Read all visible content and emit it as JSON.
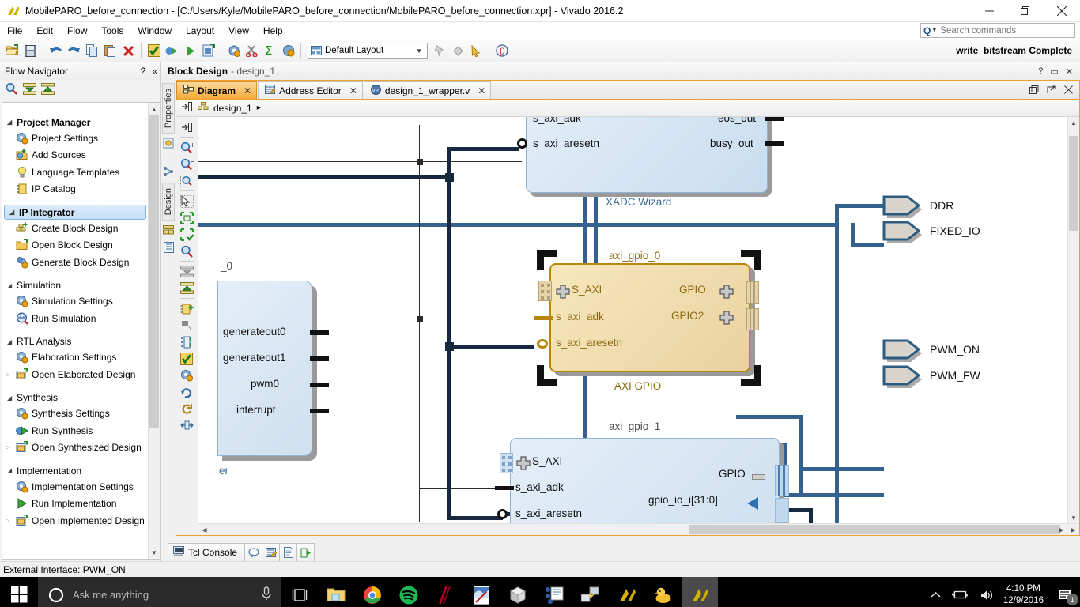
{
  "window": {
    "title": "MobilePARO_before_connection - [C:/Users/Kyle/MobilePARO_before_connection/MobilePARO_before_connection.xpr] - Vivado 2016.2",
    "minimize_label": "Minimize",
    "restore_label": "Restore",
    "close_label": "Close"
  },
  "menubar": {
    "items": [
      "File",
      "Edit",
      "Flow",
      "Tools",
      "Window",
      "Layout",
      "View",
      "Help"
    ]
  },
  "search": {
    "placeholder": "Search commands",
    "value": ""
  },
  "toolbar": {
    "layout_label": "Default Layout",
    "status_text": "write_bitstream Complete",
    "buttons": [
      "open-project-icon",
      "save-icon",
      "undo-icon",
      "redo-icon",
      "copy-icon",
      "paste-icon",
      "delete-icon",
      "validate-icon",
      "run-synthesis-icon",
      "run-implementation-icon",
      "generate-bitstream-icon",
      "settings-icon",
      "cut-icon",
      "report-icon",
      "timing-icon"
    ]
  },
  "flow_navigator": {
    "title": "Flow Navigator",
    "help_glyph": "?",
    "collapse_glyph": "«",
    "tools": [
      "search-icon",
      "collapse-all-icon",
      "expand-all-icon"
    ],
    "sections": [
      {
        "label": "Project Manager",
        "bold": true,
        "selected": false,
        "items": [
          {
            "label": "Project Settings",
            "icon": "gear-icon"
          },
          {
            "label": "Add Sources",
            "icon": "add-sources-icon"
          },
          {
            "label": "Language Templates",
            "icon": "bulb-icon"
          },
          {
            "label": "IP Catalog",
            "icon": "ip-catalog-icon"
          }
        ]
      },
      {
        "label": "IP Integrator",
        "bold": true,
        "selected": true,
        "items": [
          {
            "label": "Create Block Design",
            "icon": "create-block-design-icon"
          },
          {
            "label": "Open Block Design",
            "icon": "open-folder-icon"
          },
          {
            "label": "Generate Block Design",
            "icon": "generate-icon"
          }
        ]
      },
      {
        "label": "Simulation",
        "bold": false,
        "selected": false,
        "items": [
          {
            "label": "Simulation Settings",
            "icon": "gear-icon"
          },
          {
            "label": "Run Simulation",
            "icon": "run-simulation-icon"
          }
        ]
      },
      {
        "label": "RTL Analysis",
        "bold": false,
        "selected": false,
        "items": [
          {
            "label": "Elaboration Settings",
            "icon": "gear-icon"
          },
          {
            "label": "Open Elaborated Design",
            "icon": "open-folder-icon",
            "expander": true
          }
        ]
      },
      {
        "label": "Synthesis",
        "bold": false,
        "selected": false,
        "items": [
          {
            "label": "Synthesis Settings",
            "icon": "gear-icon"
          },
          {
            "label": "Run Synthesis",
            "icon": "run-synthesis-icon"
          },
          {
            "label": "Open Synthesized Design",
            "icon": "open-folder-icon",
            "expander": true
          }
        ]
      },
      {
        "label": "Implementation",
        "bold": false,
        "selected": false,
        "items": [
          {
            "label": "Implementation Settings",
            "icon": "gear-icon"
          },
          {
            "label": "Run Implementation",
            "icon": "play-icon"
          },
          {
            "label": "Open Implemented Design",
            "icon": "open-folder-icon",
            "expander": true
          }
        ]
      }
    ]
  },
  "block_design": {
    "header_title": "Block Design",
    "header_sub": "- design_1",
    "side_tabs": [
      {
        "label": "Properties",
        "icon": "properties-icon"
      },
      {
        "label": "Design",
        "icon": "design-icon"
      }
    ],
    "tabs": [
      {
        "label": "Diagram",
        "icon": "diagram-icon",
        "active": true,
        "closable": true
      },
      {
        "label": "Address Editor",
        "icon": "address-editor-icon",
        "active": false,
        "closable": true
      },
      {
        "label": "design_1_wrapper.v",
        "icon": "verilog-icon",
        "active": false,
        "closable": true
      }
    ],
    "breadcrumb": {
      "root": "design_1",
      "arrow": "▸"
    },
    "canvas_tools": [
      "select-area-icon",
      "zoom-in-icon",
      "zoom-out-icon",
      "zoom-fit-icon",
      "select-tool-icon",
      "fit-selection-icon",
      "auto-fit-icon",
      "search-icon",
      "collapse-all-icon",
      "expand-all-icon",
      "add-ip-icon",
      "pointer-icon",
      "regenerate-layout-icon",
      "validate-design-icon",
      "settings-icon",
      "refresh-icon",
      "redo-icon",
      "resize-icon"
    ]
  },
  "diagram": {
    "blocks": [
      {
        "id": "xadc",
        "instance_name": "",
        "type_name": "XADC Wizard",
        "style": "blue",
        "input_pins": [
          "s_axi_adk",
          "s_axi_aresetn"
        ],
        "output_pins": [
          "eos_out",
          "busy_out"
        ]
      },
      {
        "id": "timer",
        "instance_name": "_0",
        "type_name": "er",
        "style": "blue",
        "input_pins": [],
        "output_pins": [
          "generateout0",
          "generateout1",
          "pwm0",
          "interrupt"
        ]
      },
      {
        "id": "axi_gpio_0",
        "instance_name": "axi_gpio_0",
        "type_name": "AXI GPIO",
        "style": "gold-selected",
        "bus_pins_in": [
          "S_AXI"
        ],
        "input_pins": [
          "s_axi_adk",
          "s_axi_aresetn"
        ],
        "bus_pins_out": [
          "GPIO",
          "GPIO2"
        ]
      },
      {
        "id": "axi_gpio_1",
        "instance_name": "axi_gpio_1",
        "type_name": "",
        "style": "blue",
        "bus_pins_in": [
          "S_AXI"
        ],
        "input_pins": [
          "s_axi_adk",
          "s_axi_aresetn"
        ],
        "output_pins": [
          "GPIO",
          "gpio_io_i[31:0]"
        ]
      }
    ],
    "external_ports": [
      {
        "label": "DDR"
      },
      {
        "label": "FIXED_IO"
      },
      {
        "label": "PWM_ON"
      },
      {
        "label": "PWM_FW"
      }
    ]
  },
  "console": {
    "tab_label": "Tcl Console",
    "tab_icon": "console-icon",
    "extra_icons": [
      "messages-icon",
      "log-icon",
      "reports-icon",
      "designruns-icon"
    ]
  },
  "statusbar": {
    "text": "External Interface: PWM_ON"
  },
  "taskbar": {
    "cortana_placeholder": "Ask me anything",
    "apps": [
      {
        "name": "file-explorer",
        "running": true
      },
      {
        "name": "google-chrome",
        "running": false
      },
      {
        "name": "spotify",
        "running": false
      },
      {
        "name": "opera-gx",
        "running": false
      },
      {
        "name": "paint",
        "running": true
      },
      {
        "name": "3d-builder",
        "running": false
      },
      {
        "name": "diagram-app",
        "running": true
      },
      {
        "name": "network-app",
        "running": false
      },
      {
        "name": "vivado",
        "running": false
      },
      {
        "name": "rubber-duck",
        "running": false
      },
      {
        "name": "vivado-active",
        "running": true,
        "active": true
      }
    ],
    "clock_time": "4:10 PM",
    "clock_date": "12/9/2016",
    "notification_count": "1"
  },
  "colors": {
    "accent_orange": "#f0a030",
    "wire_blue": "#34618e",
    "wire_dark": "#16293f",
    "block_blue_fill": "#d5e4f2",
    "block_gold_fill": "#f0dcae",
    "block_gold_border": "#b8860b",
    "taskbar_bg": "#000000"
  }
}
